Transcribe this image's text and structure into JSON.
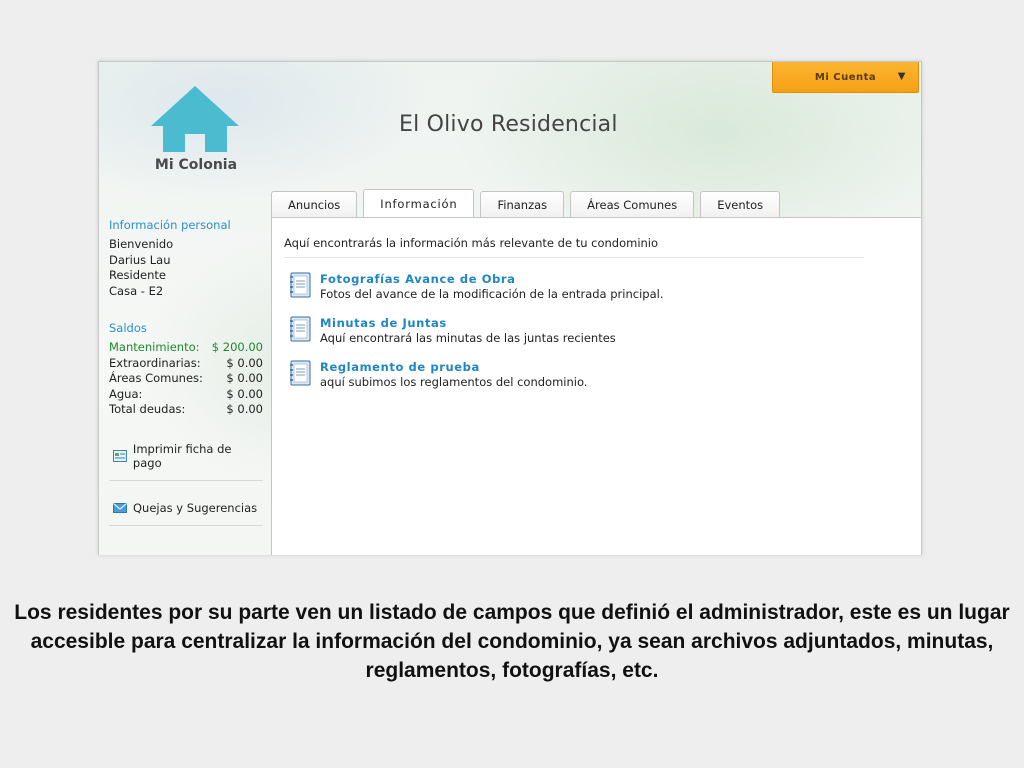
{
  "header": {
    "logo_text": "Mi Colonia",
    "site_title": "El Olivo Residencial",
    "account_label": "Mi Cuenta",
    "accent_color": "#f7a81e",
    "brand_color": "#4bbcd0"
  },
  "sidebar": {
    "personal_heading": "Información personal",
    "personal_lines": [
      "Bienvenido",
      "Darius Lau",
      "Residente",
      "Casa - E2"
    ],
    "balances_heading": "Saldos",
    "balances": [
      {
        "label": "Mantenimiento:",
        "value": "$ 200.00"
      },
      {
        "label": "Extraordinarias:",
        "value": "$ 0.00"
      },
      {
        "label": "Áreas Comunes:",
        "value": "$ 0.00"
      },
      {
        "label": "Agua:",
        "value": "$ 0.00"
      },
      {
        "label": "Total deudas:",
        "value": "$ 0.00"
      }
    ],
    "actions": [
      {
        "label": "Imprimir ficha de pago",
        "icon": "print-receipt-icon"
      },
      {
        "label": "Quejas y Sugerencias",
        "icon": "envelope-icon"
      }
    ]
  },
  "tabs": [
    {
      "label": "Anuncios"
    },
    {
      "label": "Información"
    },
    {
      "label": "Finanzas"
    },
    {
      "label": "Áreas Comunes"
    },
    {
      "label": "Eventos"
    }
  ],
  "main": {
    "intro": "Aquí encontrarás la información más relevante de tu condominio",
    "items": [
      {
        "title": "Fotografías Avance de Obra",
        "description": "Fotos del avance de la modificación de la entrada principal."
      },
      {
        "title": "Minutas de Juntas",
        "description": "Aquí encontrará las minutas de las juntas recientes"
      },
      {
        "title": "Reglamento de prueba",
        "description": "aquí subimos los reglamentos del condominio."
      }
    ]
  },
  "caption": "Los residentes por su parte ven un listado de campos que definió el administrador, este es un lugar accesible para centralizar la información del condominio, ya sean archivos adjuntados, minutas, reglamentos, fotografías, etc."
}
